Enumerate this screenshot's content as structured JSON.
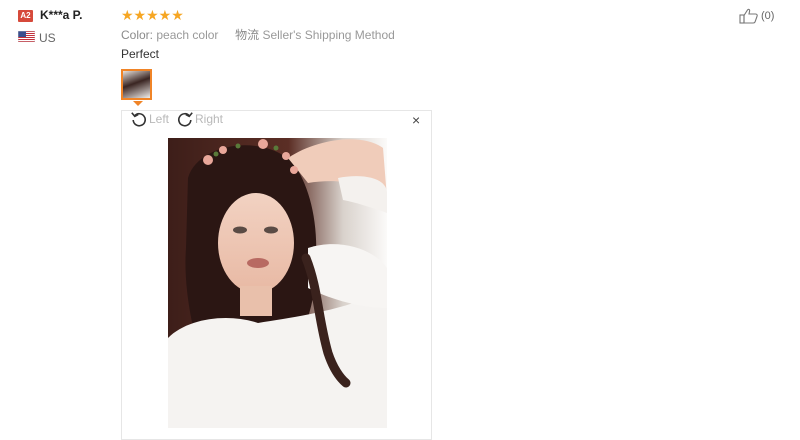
{
  "reviewer": {
    "badge": "A2",
    "name": "K***a P.",
    "country": "US"
  },
  "review": {
    "rating": 5,
    "stars": "★★★★★",
    "color_label": "Color:",
    "color_value": "peach color",
    "shipping_label": "物流",
    "shipping_value": "Seller's Shipping Method",
    "text": "Perfect"
  },
  "viewer": {
    "rotate_left": "Left",
    "rotate_right": "Right",
    "close": "×"
  },
  "helpful": {
    "count": "(0)"
  },
  "colors": {
    "star": "#f6a623",
    "accent": "#f08427",
    "badge": "#d64a3b"
  }
}
